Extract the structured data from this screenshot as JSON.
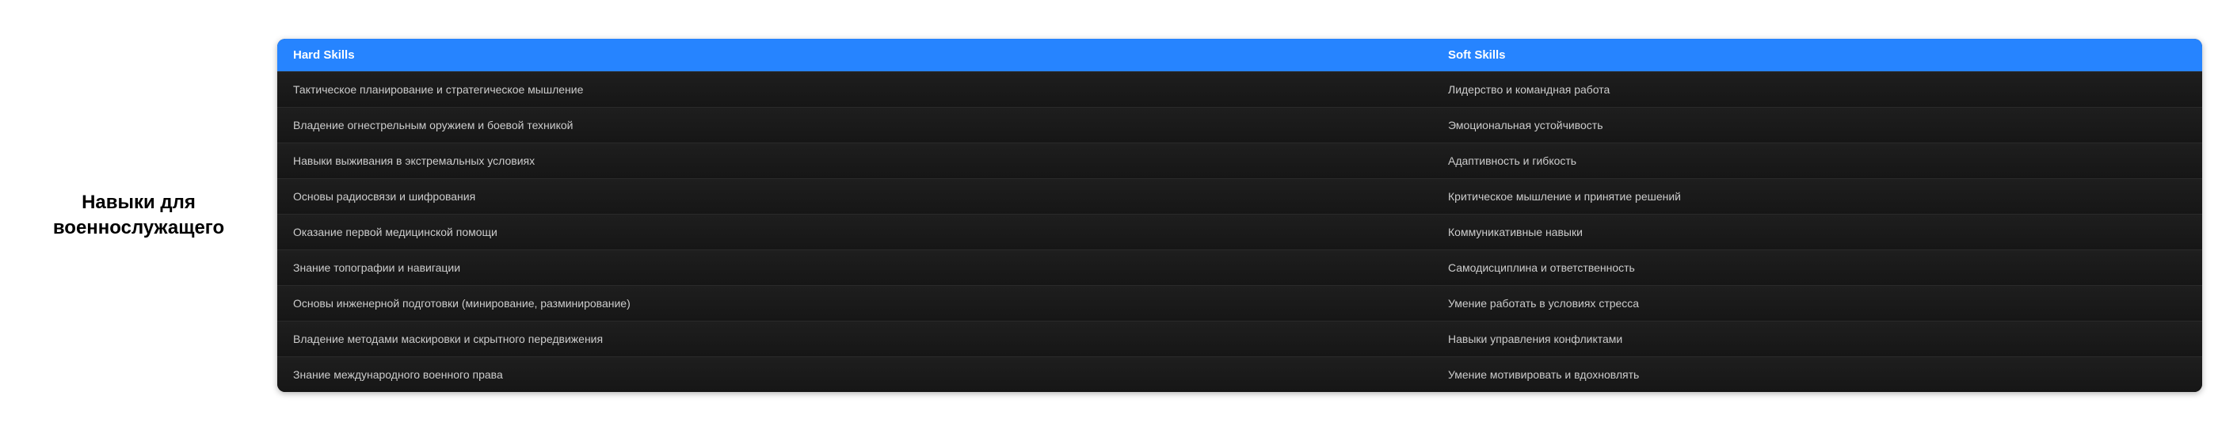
{
  "title": "Навыки для военнослужащего",
  "headers": {
    "hard": "Hard Skills",
    "soft": "Soft Skills"
  },
  "rows": [
    {
      "hard": "Тактическое планирование и стратегическое мышление",
      "soft": "Лидерство и командная работа"
    },
    {
      "hard": "Владение огнестрельным оружием и боевой техникой",
      "soft": "Эмоциональная устойчивость"
    },
    {
      "hard": "Навыки выживания в экстремальных условиях",
      "soft": "Адаптивность и гибкость"
    },
    {
      "hard": "Основы радиосвязи и шифрования",
      "soft": "Критическое мышление и принятие решений"
    },
    {
      "hard": "Оказание первой медицинской помощи",
      "soft": "Коммуникативные навыки"
    },
    {
      "hard": "Знание топографии и навигации",
      "soft": "Самодисциплина и ответственность"
    },
    {
      "hard": "Основы инженерной подготовки (минирование, разминирование)",
      "soft": "Умение работать в условиях стресса"
    },
    {
      "hard": "Владение методами маскировки и скрытного передвижения",
      "soft": "Навыки управления конфликтами"
    },
    {
      "hard": "Знание международного военного права",
      "soft": "Умение мотивировать и вдохновлять"
    }
  ]
}
